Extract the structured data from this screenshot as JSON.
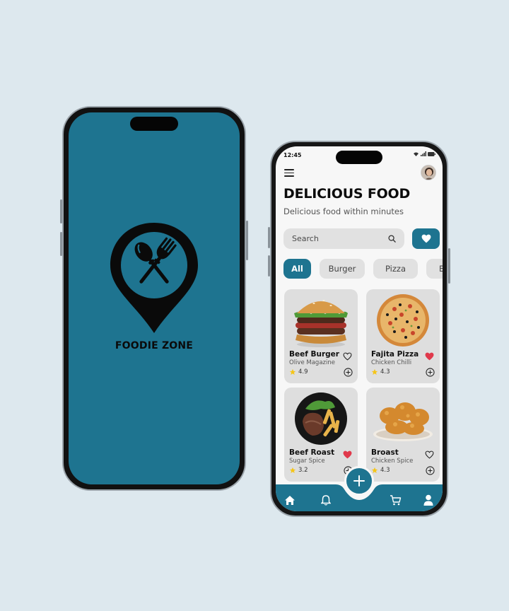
{
  "splash": {
    "brand_name": "FOODIE ZONE",
    "logo_icon": "location-pin-spoon-fork-icon",
    "background_color": "#1e7490"
  },
  "app": {
    "status_bar": {
      "time": "12:45",
      "icons": [
        "wifi-icon",
        "signal-icon",
        "battery-icon"
      ]
    },
    "header": {
      "menu_icon": "hamburger-menu-icon",
      "avatar": "user-avatar"
    },
    "title": "DELICIOUS FOOD",
    "subtitle": "Delicious food within minutes",
    "search": {
      "placeholder": "Search",
      "value": ""
    },
    "favorites_button": "heart-icon",
    "categories": [
      {
        "label": "All",
        "active": true
      },
      {
        "label": "Burger",
        "active": false
      },
      {
        "label": "Pizza",
        "active": false
      },
      {
        "label": "B",
        "active": false
      }
    ],
    "items": [
      {
        "name": "Beef Burger",
        "source": "Olive Magazine",
        "rating": "4.9",
        "favorite": false
      },
      {
        "name": "Fajita Pizza",
        "source": "Chicken Chilli",
        "rating": "4.3",
        "favorite": true
      },
      {
        "name": "Beef Roast",
        "source": "Sugar Spice",
        "rating": "3.2",
        "favorite": true
      },
      {
        "name": "Broast",
        "source": "Chicken Spice",
        "rating": "4.3",
        "favorite": false
      }
    ],
    "bottom_nav": [
      "home",
      "notifications",
      "add",
      "cart",
      "profile"
    ],
    "colors": {
      "accent": "#1e7490",
      "heart_active": "#e0394b",
      "star": "#f5c518"
    }
  }
}
